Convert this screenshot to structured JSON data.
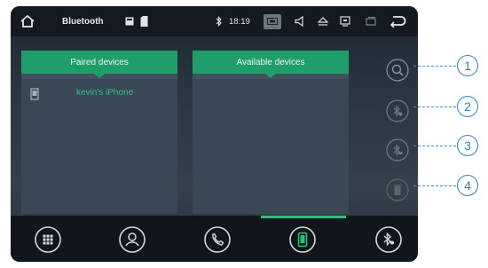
{
  "statusbar": {
    "title": "Bluetooth",
    "time": "18:19"
  },
  "panels": {
    "paired": {
      "header": "Paired devices",
      "devices": [
        {
          "name": "kevin's iPhone"
        }
      ]
    },
    "available": {
      "header": "Available devices"
    }
  },
  "side_buttons": [
    {
      "icon": "search-icon",
      "callout": "1"
    },
    {
      "icon": "bluetooth-connect-icon",
      "callout": "2"
    },
    {
      "icon": "bluetooth-disconnect-icon",
      "callout": "3"
    },
    {
      "icon": "trash-icon",
      "callout": "4"
    }
  ],
  "nav": {
    "items": [
      {
        "icon": "apps-grid-icon"
      },
      {
        "icon": "contacts-icon"
      },
      {
        "icon": "phone-icon"
      },
      {
        "icon": "phone-device-icon",
        "active": true
      },
      {
        "icon": "bluetooth-music-icon"
      }
    ]
  },
  "colors": {
    "accent": "#1f9e6c",
    "device_text": "#2ec27e",
    "callout": "#2f7fc7"
  }
}
